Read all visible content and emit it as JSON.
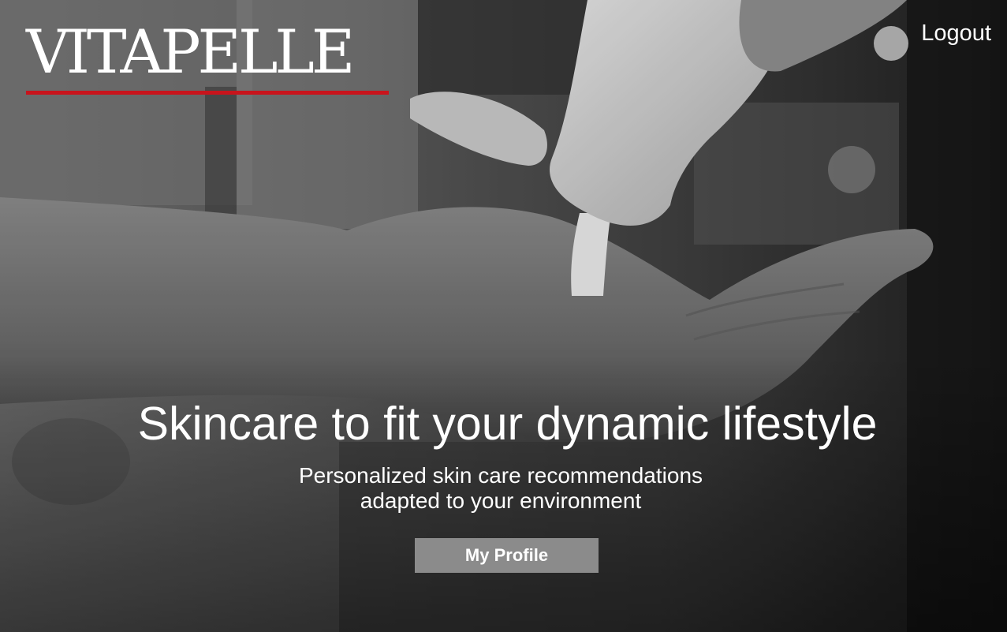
{
  "header": {
    "brand": "VITAPELLE",
    "brand_accent_color": "#c8141c",
    "logout_label": "Logout"
  },
  "hero": {
    "image_icon": "hand-lotion-photo",
    "headline": "Skincare to fit your dynamic lifestyle",
    "subhead_lines": [
      "Personalized skin care recommendations",
      "adapted to your environment"
    ],
    "cta_label": "My Profile",
    "cta_color": "#8b8b8b"
  }
}
